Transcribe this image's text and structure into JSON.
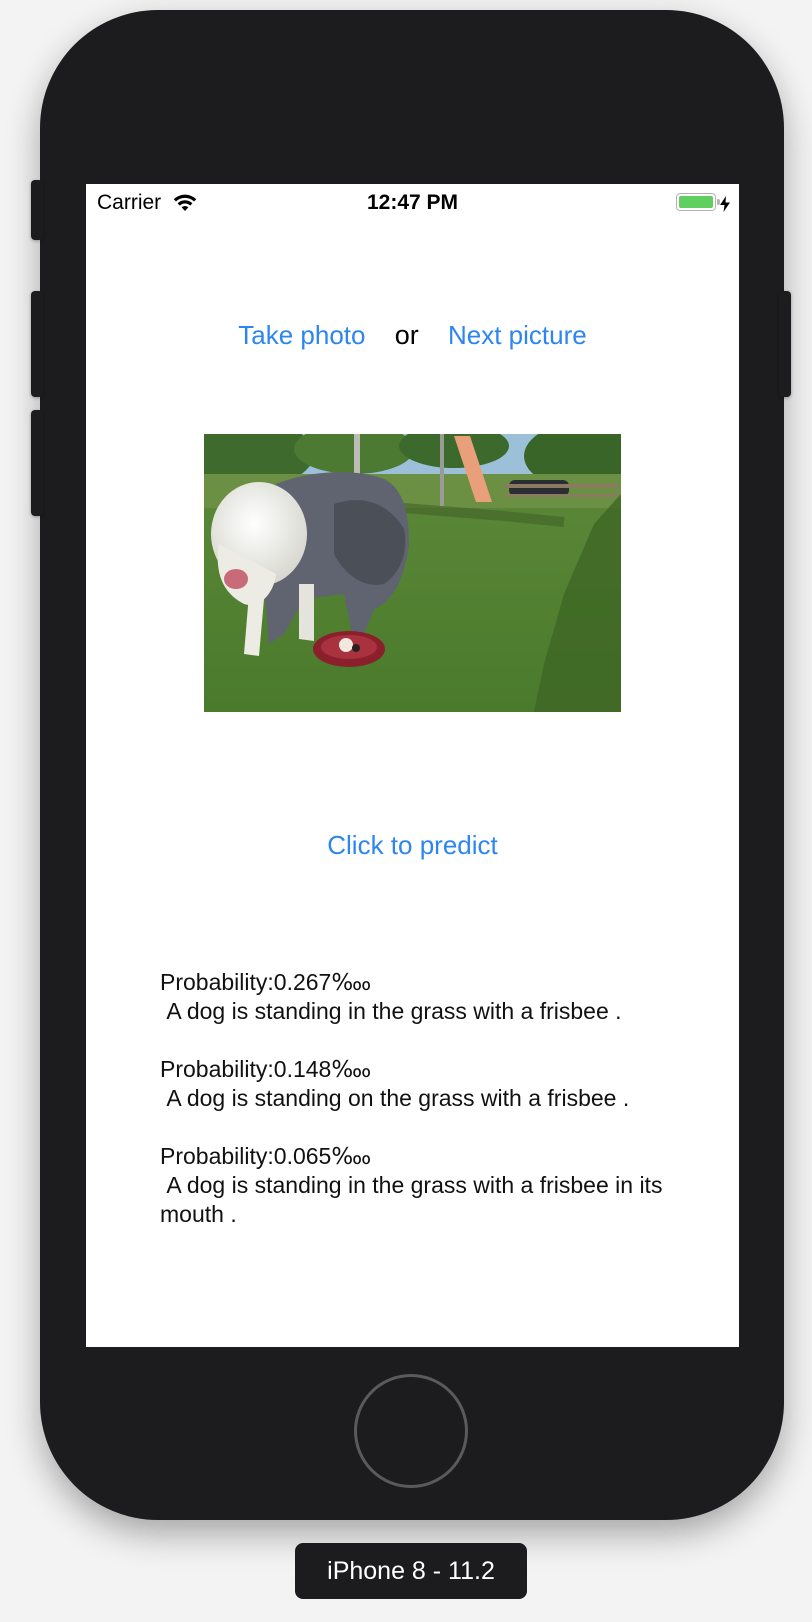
{
  "status_bar": {
    "carrier": "Carrier",
    "time": "12:47 PM",
    "wifi_icon": "wifi-icon",
    "battery_icon": "battery-charging-icon",
    "battery_color": "#5fd060",
    "battery_level": 1.0
  },
  "actions": {
    "take_photo": "Take photo",
    "or_text": "or",
    "next_picture": "Next picture"
  },
  "photo": {
    "description_icon": "dog-frisbee-photo"
  },
  "predict_button": "Click to predict",
  "results": [
    {
      "probability": "Probability:0.267‱",
      "caption": " A dog is standing in the grass with a frisbee ."
    },
    {
      "probability": "Probability:0.148‱",
      "caption": " A dog is standing on the grass with a frisbee ."
    },
    {
      "probability": "Probability:0.065‱",
      "caption": " A dog is standing in the grass with a frisbee in its mouth ."
    }
  ],
  "device_label": "iPhone 8 - 11.2",
  "colors": {
    "accent": "#2d86f0",
    "device_body": "#1c1c1e",
    "screen_bg": "#ffffff"
  }
}
